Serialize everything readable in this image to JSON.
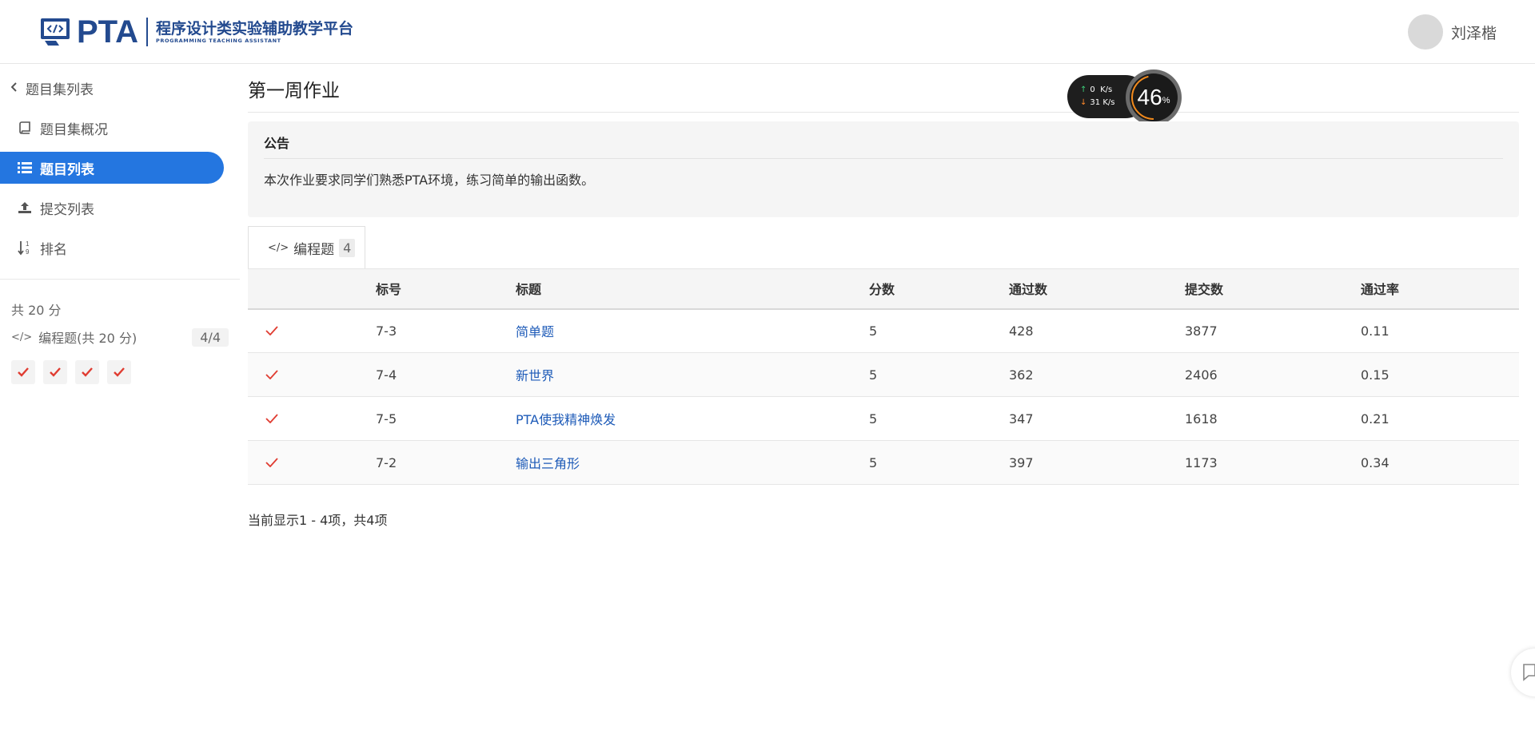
{
  "header": {
    "logo_main": "PTA",
    "logo_cn": "程序设计类实验辅助教学平台",
    "logo_en": "PROGRAMMING TEACHING ASSISTANT",
    "username": "刘泽楷"
  },
  "sidebar": {
    "back_label": "题目集列表",
    "items": [
      {
        "label": "题目集概况",
        "icon": "book-icon"
      },
      {
        "label": "题目列表",
        "icon": "list-icon",
        "active": true
      },
      {
        "label": "提交列表",
        "icon": "upload-icon"
      },
      {
        "label": "排名",
        "icon": "sort-numeric-icon"
      }
    ],
    "total_score": "共 20 分",
    "programming_summary": "编程题(共 20 分)",
    "programming_progress": "4/4",
    "status_count": 4
  },
  "main": {
    "title": "第一周作业",
    "notice_title": "公告",
    "notice_body": "本次作业要求同学们熟悉PTA环境，练习简单的输出函数。",
    "tab_label": "编程题",
    "tab_count": "4",
    "table": {
      "headers": [
        "",
        "标号",
        "标题",
        "分数",
        "通过数",
        "提交数",
        "通过率"
      ],
      "rows": [
        {
          "status": "passed",
          "id": "7-3",
          "title": "简单题",
          "score": "5",
          "passed": "428",
          "submitted": "3877",
          "rate": "0.11"
        },
        {
          "status": "passed",
          "id": "7-4",
          "title": "新世界",
          "score": "5",
          "passed": "362",
          "submitted": "2406",
          "rate": "0.15"
        },
        {
          "status": "passed",
          "id": "7-5",
          "title": "PTA使我精神焕发",
          "score": "5",
          "passed": "347",
          "submitted": "1618",
          "rate": "0.21"
        },
        {
          "status": "passed",
          "id": "7-2",
          "title": "输出三角形",
          "score": "5",
          "passed": "397",
          "submitted": "1173",
          "rate": "0.34"
        }
      ]
    },
    "pager_info": "当前显示1 - 4项，共4项"
  },
  "overlay": {
    "upload_speed": "0",
    "download_speed": "31",
    "speed_unit": "K/s",
    "gauge_value": "46",
    "gauge_unit": "%"
  },
  "colors": {
    "accent": "#2476e0",
    "brand": "#234a8f",
    "link": "#1e5bb8",
    "check": "#e03c31"
  }
}
